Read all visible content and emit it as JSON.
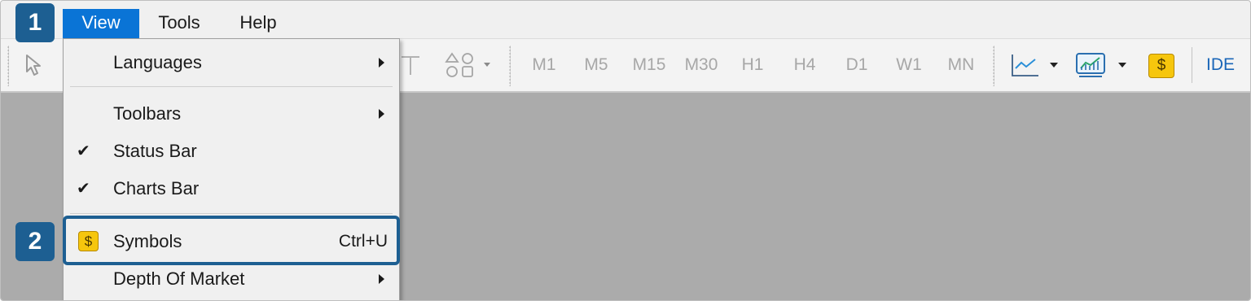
{
  "menubar": {
    "items": [
      {
        "label": "View",
        "active": true
      },
      {
        "label": "Tools"
      },
      {
        "label": "Help"
      }
    ]
  },
  "toolbar": {
    "timeframes": [
      "M1",
      "M5",
      "M15",
      "M30",
      "H1",
      "H4",
      "D1",
      "W1",
      "MN"
    ],
    "ide_label": "IDE",
    "icons": [
      "cursor-icon",
      "text-tool-icon",
      "shapes-icon",
      "line-chart-icon",
      "chart-template-icon",
      "symbols-icon"
    ],
    "symbols_glyph": "$"
  },
  "view_menu": {
    "items": [
      {
        "label": "Languages",
        "submenu": true
      },
      {
        "label": "Toolbars",
        "submenu": true
      },
      {
        "label": "Status Bar",
        "checked": true
      },
      {
        "label": "Charts Bar",
        "checked": true
      },
      {
        "label": "Symbols",
        "shortcut": "Ctrl+U",
        "icon": "$"
      },
      {
        "label": "Depth Of Market",
        "submenu": true
      }
    ],
    "check_glyph": "✔"
  },
  "steps": {
    "step1": "1",
    "step2": "2"
  },
  "colors": {
    "accent": "#0a74d6",
    "badge": "#1d5f92",
    "workspace": "#ababab",
    "symbol_icon": "#f6c60d"
  }
}
